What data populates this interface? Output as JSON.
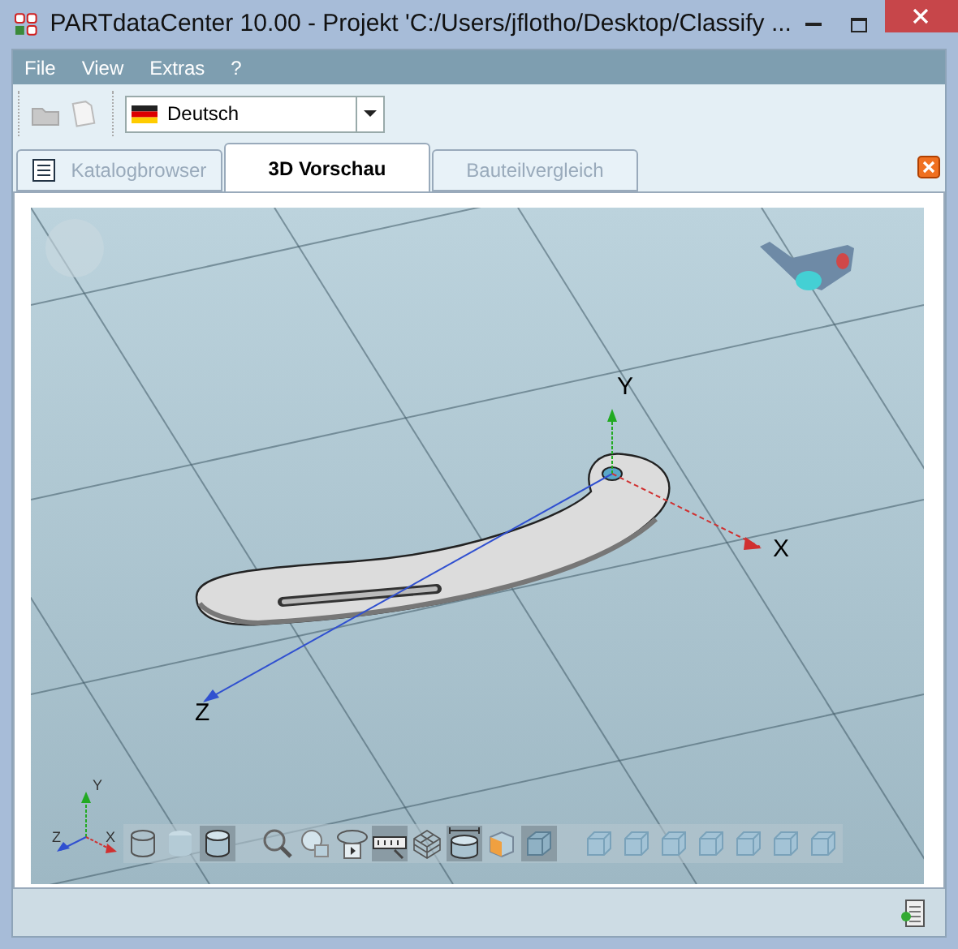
{
  "window": {
    "title": "PARTdataCenter 10.00 - Projekt 'C:/Users/jflotho/Desktop/Classify ..."
  },
  "menu": [
    "File",
    "View",
    "Extras",
    "?"
  ],
  "toolbar": {
    "language": "Deutsch"
  },
  "tabs": [
    {
      "label": "Katalogbrowser",
      "selected": false,
      "kind": "catalog"
    },
    {
      "label": "3D Vorschau",
      "selected": true,
      "kind": "plain"
    },
    {
      "label": "Bauteilvergleich",
      "selected": false,
      "kind": "plain"
    }
  ],
  "viewer": {
    "axes": {
      "x": "X",
      "y": "Y",
      "z": "Z"
    },
    "triad": {
      "x": "X",
      "y": "Y",
      "z": "Z"
    },
    "tools": [
      {
        "kind": "cylinder-outline",
        "selected": false
      },
      {
        "kind": "cylinder-faded",
        "selected": false
      },
      {
        "kind": "cylinder",
        "selected": true
      },
      {
        "kind": "zoom",
        "selected": false
      },
      {
        "kind": "zoom-part",
        "selected": false
      },
      {
        "kind": "rotate",
        "selected": false
      },
      {
        "kind": "ruler",
        "selected": true
      },
      {
        "kind": "wireframe",
        "selected": false
      },
      {
        "kind": "cylinder-measure",
        "selected": true
      },
      {
        "kind": "section",
        "selected": false
      },
      {
        "kind": "cube",
        "selected": true
      },
      {
        "kind": "view-cube",
        "selected": false
      },
      {
        "kind": "view-cube",
        "selected": false
      },
      {
        "kind": "view-cube",
        "selected": false
      },
      {
        "kind": "view-cube",
        "selected": false
      },
      {
        "kind": "view-cube",
        "selected": false
      },
      {
        "kind": "view-cube",
        "selected": false
      },
      {
        "kind": "view-cube",
        "selected": false
      }
    ]
  }
}
